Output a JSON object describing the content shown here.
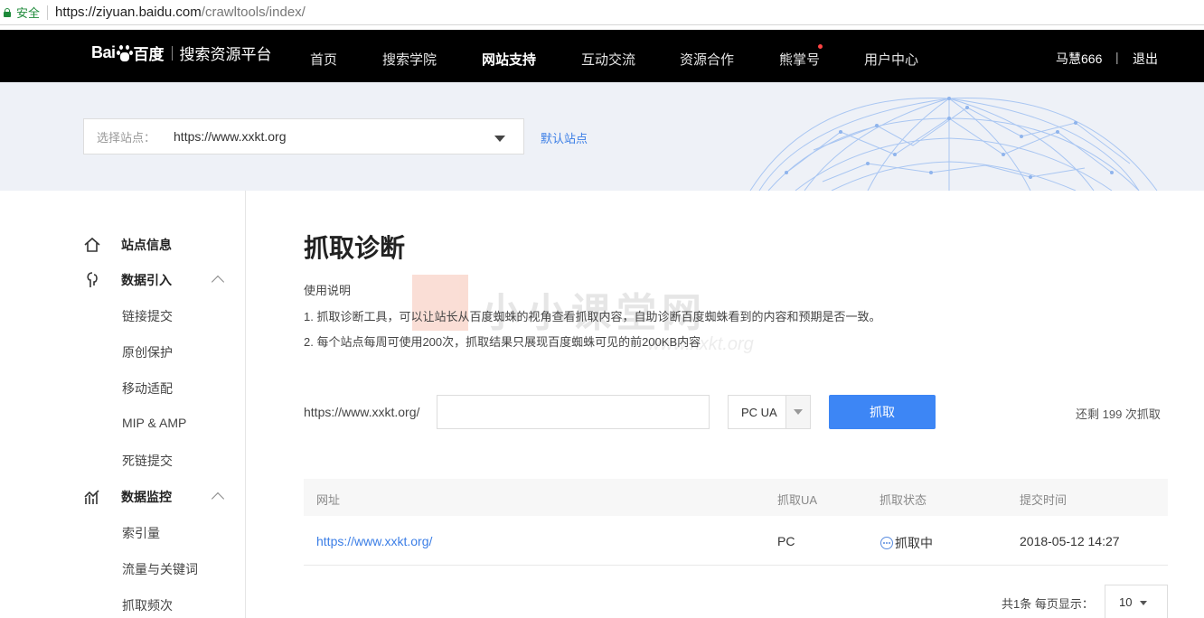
{
  "browser": {
    "secure_label": "安全",
    "url_host": "https://ziyuan.baidu.com",
    "url_path": "/crawltools/index/"
  },
  "header": {
    "logo_text_left": "Bai",
    "logo_text_cn": "百度",
    "platform_name": "搜索资源平台",
    "nav": [
      "首页",
      "搜索学院",
      "网站支持",
      "互动交流",
      "资源合作",
      "熊掌号",
      "用户中心"
    ],
    "active_nav": "网站支持",
    "user_name": "马慧666",
    "divider": "|",
    "logout": "退出"
  },
  "banner": {
    "select_label": "选择站点：",
    "selected_site": "https://www.xxkt.org",
    "default_site_link": "默认站点"
  },
  "sidebar": {
    "site_info": "站点信息",
    "data_import": {
      "label": "数据引入",
      "items": [
        "链接提交",
        "原创保护",
        "移动适配",
        "MIP & AMP",
        "死链提交"
      ]
    },
    "data_monitor": {
      "label": "数据监控",
      "items": [
        "索引量",
        "流量与关键词",
        "抓取频次"
      ]
    }
  },
  "main": {
    "title": "抓取诊断",
    "instructions_heading": "使用说明",
    "instructions": [
      "1. 抓取诊断工具，可以让站长从百度蜘蛛的视角查看抓取内容，自助诊断百度蜘蛛看到的内容和预期是否一致。",
      "2. 每个站点每周可使用200次，抓取结果只展现百度蜘蛛可见的前200KB内容"
    ],
    "watermark_text": "小小课堂网",
    "watermark_url": "www.xxkt.org",
    "url_prefix": "https://www.xxkt.org/",
    "path_value": "",
    "ua_value": "PC UA",
    "fetch_button": "抓取",
    "remaining": "还剩 199 次抓取"
  },
  "table": {
    "headers": [
      "网址",
      "抓取UA",
      "抓取状态",
      "提交时间"
    ],
    "rows": [
      {
        "url": "https://www.xxkt.org/",
        "ua": "PC",
        "status": "抓取中",
        "time": "2018-05-12 14:27"
      }
    ]
  },
  "pagination": {
    "summary": "共1条  每页显示：",
    "page_size": "10"
  }
}
